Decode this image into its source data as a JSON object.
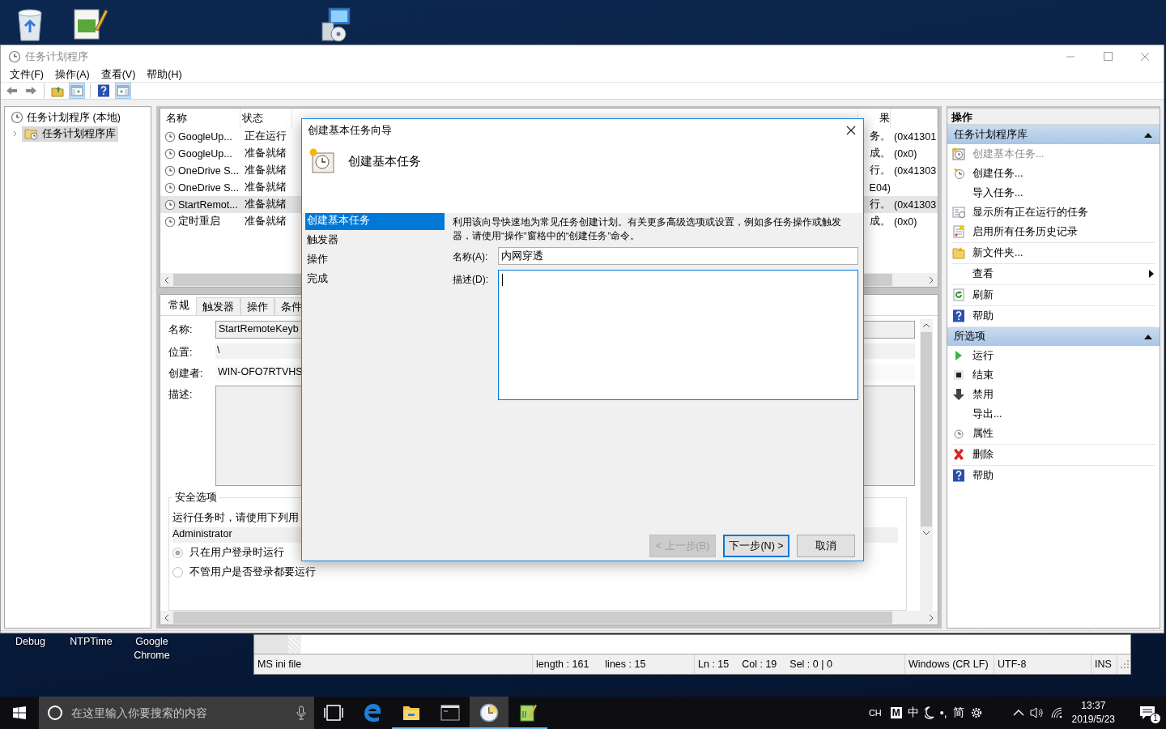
{
  "desktop_labels": [
    "Debug",
    "NTPTime",
    "Google Chrome"
  ],
  "main_window": {
    "title": "任务计划程序",
    "menu": [
      "文件(F)",
      "操作(A)",
      "查看(V)",
      "帮助(H)"
    ],
    "toolbar": [
      [
        {
          "kind": "back",
          "on": false
        },
        {
          "kind": "forward",
          "on": false
        }
      ],
      [
        {
          "kind": "up-folder",
          "on": false
        },
        {
          "kind": "console-tree",
          "on": true
        }
      ],
      [
        {
          "kind": "help",
          "on": false
        },
        {
          "kind": "action-pane",
          "on": true
        }
      ]
    ],
    "tree": [
      {
        "label": "任务计划程序 (本地)",
        "selected": false,
        "children": [
          {
            "label": "任务计划程序库",
            "selected": true,
            "expanded": false
          }
        ]
      }
    ],
    "task_list": {
      "columns": [
        "名称",
        "状态",
        "果"
      ],
      "rows": [
        {
          "cells": [
            "GoogleUp...",
            "正在运行",
            "务。",
            "(0x41301"
          ],
          "selected": false
        },
        {
          "cells": [
            "GoogleUp...",
            "准备就绪",
            "成。",
            "(0x0)"
          ],
          "selected": false
        },
        {
          "cells": [
            "OneDrive S...",
            "准备就绪",
            "行。",
            "(0x41303"
          ],
          "selected": false
        },
        {
          "cells": [
            "OneDrive S...",
            "准备就绪",
            "E04)"
          ],
          "selected": false
        },
        {
          "cells": [
            "StartRemot...",
            "准备就绪",
            "行。",
            "(0x41303"
          ],
          "selected": true
        },
        {
          "cells": [
            "定时重启",
            "准备就绪",
            "成。",
            "(0x0)"
          ],
          "selected": false
        }
      ]
    },
    "details": {
      "tabs": [
        {
          "label": "常规",
          "selected": true
        },
        {
          "label": "触发器",
          "selected": false
        },
        {
          "label": "操作",
          "selected": false
        },
        {
          "label": "条件",
          "selected": false
        }
      ],
      "name_label": "名称:",
      "name_value": "StartRemoteKeyb",
      "location_label": "位置:",
      "location_value": "\\",
      "author_label": "创建者:",
      "author_value": "WIN-OFO7RTVHS",
      "description_label": "描述:",
      "security": {
        "title": "安全选项",
        "prompt": "运行任务时，请使用下列用",
        "account": "Administrator",
        "options": [
          {
            "label": "只在用户登录时运行",
            "selected": true
          },
          {
            "label": "不管用户是否登录都要运行",
            "selected": false
          }
        ]
      }
    },
    "actions": {
      "title": "操作",
      "sections": [
        {
          "title": "任务计划程序库",
          "expanded": true,
          "groups": [
            [
              {
                "label": "创建基本任务...",
                "kind": "create-basic",
                "disabled": true
              },
              {
                "label": "创建任务...",
                "kind": "create",
                "disabled": false
              },
              {
                "label": "导入任务...",
                "kind": "plain",
                "disabled": false
              },
              {
                "label": "显示所有正在运行的任务",
                "kind": "running",
                "disabled": false
              },
              {
                "label": "启用所有任务历史记录",
                "kind": "history",
                "disabled": false
              }
            ],
            [
              {
                "label": "新文件夹...",
                "kind": "folder",
                "disabled": false
              }
            ],
            [
              {
                "label": "查看",
                "kind": "submenu",
                "disabled": false
              }
            ],
            [
              {
                "label": "刷新",
                "kind": "refresh",
                "disabled": false
              }
            ],
            [
              {
                "label": "帮助",
                "kind": "help",
                "disabled": false
              }
            ]
          ]
        },
        {
          "title": "所选项",
          "expanded": true,
          "groups": [
            [
              {
                "label": "运行",
                "kind": "run",
                "disabled": false
              },
              {
                "label": "结束",
                "kind": "stop",
                "disabled": false
              },
              {
                "label": "禁用",
                "kind": "disable",
                "disabled": false
              },
              {
                "label": "导出...",
                "kind": "plain",
                "disabled": false
              },
              {
                "label": "属性",
                "kind": "properties",
                "disabled": false
              }
            ],
            [
              {
                "label": "删除",
                "kind": "delete",
                "disabled": false
              }
            ],
            [
              {
                "label": "帮助",
                "kind": "help",
                "disabled": false
              }
            ]
          ]
        }
      ]
    }
  },
  "dialog": {
    "title": "创建基本任务向导",
    "heading": "创建基本任务",
    "steps": [
      {
        "label": "创建基本任务",
        "selected": true
      },
      {
        "label": "触发器",
        "selected": false
      },
      {
        "label": "操作",
        "selected": false
      },
      {
        "label": "完成",
        "selected": false
      }
    ],
    "intro": "利用该向导快速地为常见任务创建计划。有关更多高级选项或设置，例如多任务操作或触发器，请使用“操作”窗格中的“创建任务”命令。",
    "name_label": "名称(A):",
    "name_value": "内网穿透",
    "description_label": "描述(D):",
    "description_focused": true,
    "buttons": [
      {
        "label": "< 上一步(B)",
        "kind": "back",
        "disabled": true
      },
      {
        "label": "下一步(N) >",
        "kind": "next",
        "disabled": false
      },
      {
        "label": "取消",
        "kind": "cancel",
        "disabled": false
      }
    ]
  },
  "editor": {
    "status_groups": [
      [
        "MS ini file"
      ],
      [
        "length : 161",
        "lines : 15"
      ],
      [
        "Ln : 15",
        "Col : 19",
        "Sel : 0 | 0"
      ],
      [
        "Windows (CR LF)"
      ],
      [
        "UTF-8"
      ],
      [
        "INS"
      ]
    ]
  },
  "taskbar": {
    "search_placeholder": "在这里输入你要搜索的内容",
    "apps": [
      {
        "kind": "task-view",
        "running": false,
        "active": false
      },
      {
        "kind": "edge",
        "running": false,
        "active": false
      },
      {
        "kind": "explorer",
        "running": true,
        "active": false
      },
      {
        "kind": "terminal",
        "running": true,
        "active": false
      },
      {
        "kind": "clock",
        "running": true,
        "active": true
      },
      {
        "kind": "notepad",
        "running": true,
        "active": false
      }
    ],
    "ime": [
      {
        "kind": "text",
        "text": "CH"
      },
      {
        "kind": "boxed",
        "text": "M"
      },
      {
        "kind": "text",
        "text": "中"
      },
      {
        "kind": "moon"
      },
      {
        "kind": "text",
        "text": "•,"
      },
      {
        "kind": "text",
        "text": "简"
      },
      {
        "kind": "gear"
      }
    ],
    "time": "13:37",
    "date": "2019/5/23",
    "notifications": "1"
  }
}
